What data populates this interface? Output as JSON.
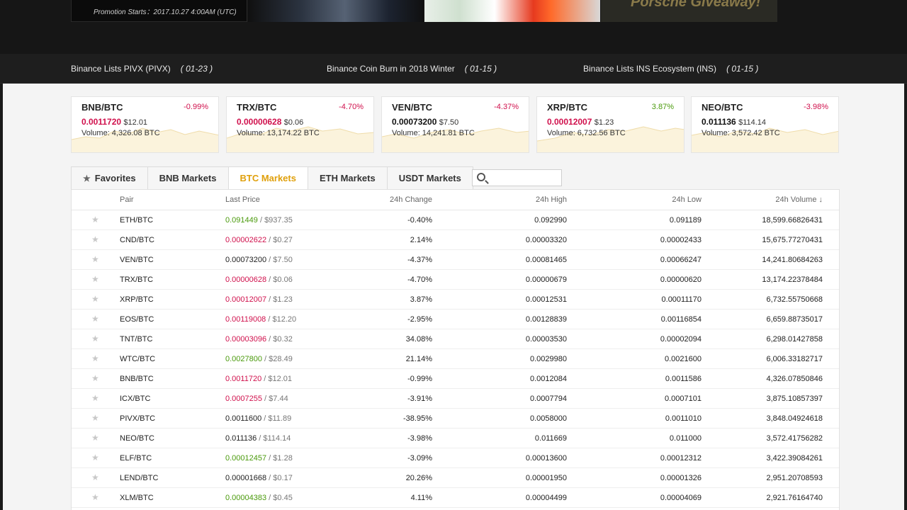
{
  "banners": {
    "promo_text": "Promotion Starts：2017.10.27 4:00AM (UTC)",
    "giveaway_text": "Porsche Giveaway!"
  },
  "news": [
    {
      "title": "Binance Lists PIVX (PIVX)",
      "date": "( 01-23 )"
    },
    {
      "title": "Binance Coin Burn in 2018 Winter",
      "date": "( 01-15 )"
    },
    {
      "title": "Binance Lists INS Ecosystem (INS)",
      "date": "( 01-15 )"
    }
  ],
  "tickers": [
    {
      "pair": "BNB/BTC",
      "change": "-0.99%",
      "price": "0.0011720",
      "usd": "$12.01",
      "volume": "Volume: 4,326.08 BTC",
      "change_color": "red",
      "price_color": "red"
    },
    {
      "pair": "TRX/BTC",
      "change": "-4.70%",
      "price": "0.00000628",
      "usd": "$0.06",
      "volume": "Volume: 13,174.22 BTC",
      "change_color": "red",
      "price_color": "red"
    },
    {
      "pair": "VEN/BTC",
      "change": "-4.37%",
      "price": "0.00073200",
      "usd": "$7.50",
      "volume": "Volume: 14,241.81 BTC",
      "change_color": "red",
      "price_color": "black"
    },
    {
      "pair": "XRP/BTC",
      "change": "3.87%",
      "price": "0.00012007",
      "usd": "$1.23",
      "volume": "Volume: 6,732.56 BTC",
      "change_color": "green",
      "price_color": "red"
    },
    {
      "pair": "NEO/BTC",
      "change": "-3.98%",
      "price": "0.011136",
      "usd": "$114.14",
      "volume": "Volume: 3,572.42 BTC",
      "change_color": "red",
      "price_color": "black"
    }
  ],
  "tabs": {
    "favorites": "Favorites",
    "bnb": "BNB Markets",
    "btc": "BTC Markets",
    "eth": "ETH Markets",
    "usdt": "USDT Markets"
  },
  "search": {
    "placeholder": ""
  },
  "table": {
    "headers": {
      "pair": "Pair",
      "last_price": "Last Price",
      "change": "24h Change",
      "high": "24h High",
      "low": "24h Low",
      "volume": "24h Volume ↓"
    },
    "rows": [
      {
        "pair": "ETH/BTC",
        "price": "0.091449",
        "usd": "$937.35",
        "change": "-0.40%",
        "high": "0.092990",
        "low": "0.091189",
        "volume": "18,599.66826431",
        "price_color": "green",
        "change_color": "red"
      },
      {
        "pair": "CND/BTC",
        "price": "0.00002622",
        "usd": "$0.27",
        "change": "2.14%",
        "high": "0.00003320",
        "low": "0.00002433",
        "volume": "15,675.77270431",
        "price_color": "red",
        "change_color": "green"
      },
      {
        "pair": "VEN/BTC",
        "price": "0.00073200",
        "usd": "$7.50",
        "change": "-4.37%",
        "high": "0.00081465",
        "low": "0.00066247",
        "volume": "14,241.80684263",
        "price_color": "black",
        "change_color": "red"
      },
      {
        "pair": "TRX/BTC",
        "price": "0.00000628",
        "usd": "$0.06",
        "change": "-4.70%",
        "high": "0.00000679",
        "low": "0.00000620",
        "volume": "13,174.22378484",
        "price_color": "red",
        "change_color": "red"
      },
      {
        "pair": "XRP/BTC",
        "price": "0.00012007",
        "usd": "$1.23",
        "change": "3.87%",
        "high": "0.00012531",
        "low": "0.00011170",
        "volume": "6,732.55750668",
        "price_color": "red",
        "change_color": "green"
      },
      {
        "pair": "EOS/BTC",
        "price": "0.00119008",
        "usd": "$12.20",
        "change": "-2.95%",
        "high": "0.00128839",
        "low": "0.00116854",
        "volume": "6,659.88735017",
        "price_color": "red",
        "change_color": "red"
      },
      {
        "pair": "TNT/BTC",
        "price": "0.00003096",
        "usd": "$0.32",
        "change": "34.08%",
        "high": "0.00003530",
        "low": "0.00002094",
        "volume": "6,298.01427858",
        "price_color": "red",
        "change_color": "green"
      },
      {
        "pair": "WTC/BTC",
        "price": "0.0027800",
        "usd": "$28.49",
        "change": "21.14%",
        "high": "0.0029980",
        "low": "0.0021600",
        "volume": "6,006.33182717",
        "price_color": "green",
        "change_color": "green"
      },
      {
        "pair": "BNB/BTC",
        "price": "0.0011720",
        "usd": "$12.01",
        "change": "-0.99%",
        "high": "0.0012084",
        "low": "0.0011586",
        "volume": "4,326.07850846",
        "price_color": "red",
        "change_color": "red"
      },
      {
        "pair": "ICX/BTC",
        "price": "0.0007255",
        "usd": "$7.44",
        "change": "-3.91%",
        "high": "0.0007794",
        "low": "0.0007101",
        "volume": "3,875.10857397",
        "price_color": "red",
        "change_color": "red"
      },
      {
        "pair": "PIVX/BTC",
        "price": "0.0011600",
        "usd": "$11.89",
        "change": "-38.95%",
        "high": "0.0058000",
        "low": "0.0011010",
        "volume": "3,848.04924618",
        "price_color": "black",
        "change_color": "red"
      },
      {
        "pair": "NEO/BTC",
        "price": "0.011136",
        "usd": "$114.14",
        "change": "-3.98%",
        "high": "0.011669",
        "low": "0.011000",
        "volume": "3,572.41756282",
        "price_color": "black",
        "change_color": "red"
      },
      {
        "pair": "ELF/BTC",
        "price": "0.00012457",
        "usd": "$1.28",
        "change": "-3.09%",
        "high": "0.00013600",
        "low": "0.00012312",
        "volume": "3,422.39084261",
        "price_color": "green",
        "change_color": "red"
      },
      {
        "pair": "LEND/BTC",
        "price": "0.00001668",
        "usd": "$0.17",
        "change": "20.26%",
        "high": "0.00001950",
        "low": "0.00001326",
        "volume": "2,951.20708593",
        "price_color": "black",
        "change_color": "green"
      },
      {
        "pair": "XLM/BTC",
        "price": "0.00004383",
        "usd": "$0.45",
        "change": "4.11%",
        "high": "0.00004499",
        "low": "0.00004069",
        "volume": "2,921.76164740",
        "price_color": "green",
        "change_color": "green"
      }
    ]
  },
  "colors": {
    "red": "#d0104c",
    "green": "#4a9a0c",
    "accent": "#e0a00c"
  }
}
